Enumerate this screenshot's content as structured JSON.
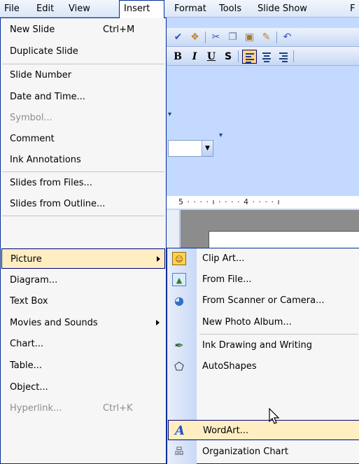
{
  "menubar": {
    "items": [
      "File",
      "Edit",
      "View",
      "Insert",
      "Format",
      "Tools",
      "Slide Show",
      "F"
    ],
    "active": "Insert"
  },
  "insert_menu": {
    "items": [
      {
        "label": "New Slide",
        "shortcut": "Ctrl+M"
      },
      {
        "label": "Duplicate Slide"
      },
      {
        "label": "Slide Number"
      },
      {
        "label": "Date and Time..."
      },
      {
        "label": "Symbol...",
        "disabled": true
      },
      {
        "label": "Comment"
      },
      {
        "label": "Ink Annotations"
      },
      {
        "label": "Slides from Files..."
      },
      {
        "label": "Slides from Outline..."
      },
      {
        "label": "Picture",
        "submenu": true,
        "highlighted": true
      },
      {
        "label": "Diagram..."
      },
      {
        "label": "Text Box"
      },
      {
        "label": "Movies and Sounds",
        "submenu": true
      },
      {
        "label": "Chart..."
      },
      {
        "label": "Table..."
      },
      {
        "label": "Object..."
      },
      {
        "label": "Hyperlink...",
        "shortcut": "Ctrl+K",
        "disabled": true
      }
    ]
  },
  "picture_submenu": {
    "items": [
      {
        "label": "Clip Art...",
        "icon": "clip-art-icon"
      },
      {
        "label": "From File...",
        "icon": "from-file-icon"
      },
      {
        "label": "From Scanner or Camera...",
        "icon": "scanner-icon"
      },
      {
        "label": "New Photo Album..."
      },
      {
        "label": "Ink Drawing and Writing",
        "icon": "ink-pen-icon"
      },
      {
        "label": "AutoShapes",
        "icon": "autoshapes-icon"
      },
      {
        "label": "WordArt...",
        "icon": "wordart-icon",
        "highlighted": true
      },
      {
        "label": "Organization Chart",
        "icon": "org-chart-icon"
      }
    ]
  },
  "formatting": {
    "bold": "B",
    "italic": "I",
    "underline": "U",
    "shadow": "S"
  },
  "ruler": {
    "marks": "5 · · · · ı · · · · 4 · · · · ı"
  },
  "colors": {
    "menu_highlight": "#ffeec2",
    "menu_border": "#002d96",
    "app_background": "#c3d9ff",
    "disabled_text": "#8d8d8d"
  }
}
